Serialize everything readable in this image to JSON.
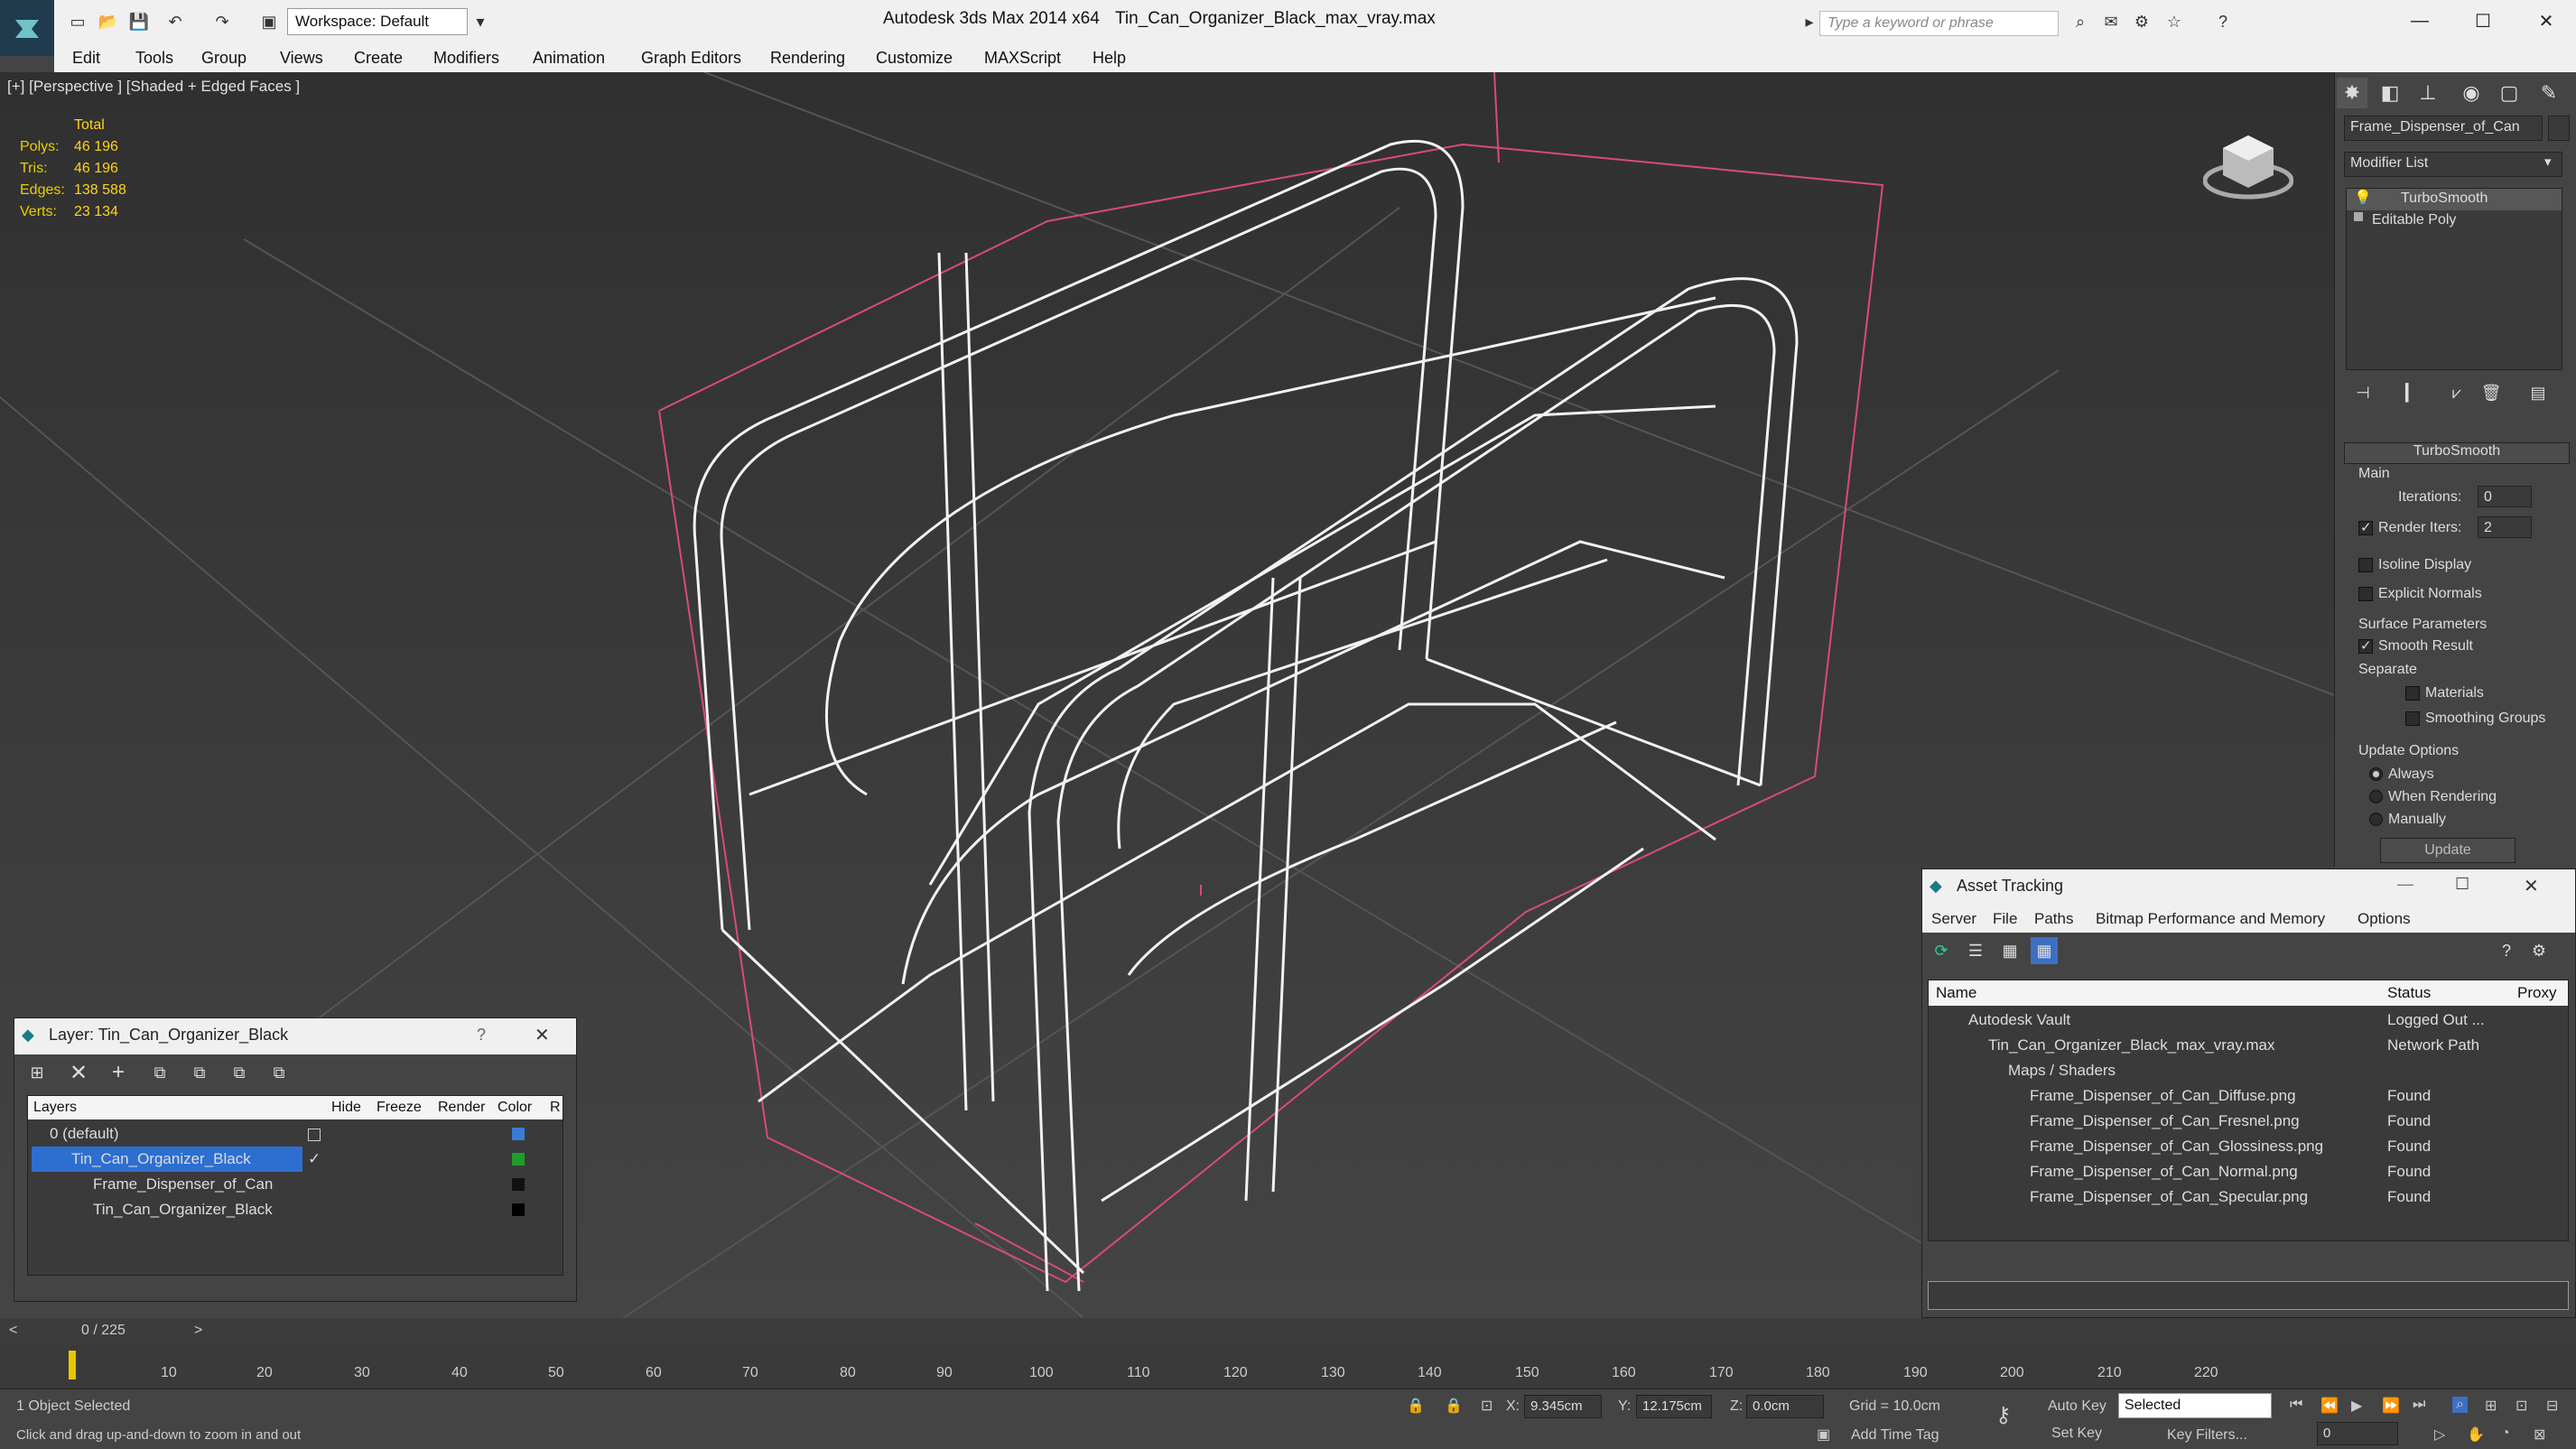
{
  "app": {
    "title": "Autodesk 3ds Max  2014 x64",
    "file": "Tin_Can_Organizer_Black_max_vray.max",
    "workspace": "Workspace: Default",
    "search_placeholder": "Type a keyword or phrase"
  },
  "menu": [
    "Edit",
    "Tools",
    "Group",
    "Views",
    "Create",
    "Modifiers",
    "Animation",
    "Graph Editors",
    "Rendering",
    "Customize",
    "MAXScript",
    "Help"
  ],
  "viewport": {
    "label": "[+] [Perspective ] [Shaded + Edged Faces ]",
    "stats": {
      "header": "Total",
      "rows": [
        {
          "k": "Polys:",
          "v": "46 196"
        },
        {
          "k": "Tris:",
          "v": "46 196"
        },
        {
          "k": "Edges:",
          "v": "138 588"
        },
        {
          "k": "Verts:",
          "v": "23 134"
        }
      ]
    }
  },
  "command_panel": {
    "object_name": "Frame_Dispenser_of_Can",
    "modifier_list": "Modifier List",
    "stack": [
      "TurboSmooth",
      "Editable Poly"
    ],
    "rollout": "TurboSmooth",
    "main": "Main",
    "iterations_label": "Iterations:",
    "iterations": "0",
    "render_iters_label": "Render Iters:",
    "render_iters": "2",
    "isoline": "Isoline Display",
    "explicit": "Explicit Normals",
    "surface": "Surface Parameters",
    "smooth": "Smooth Result",
    "separate": "Separate",
    "materials": "Materials",
    "smoothing": "Smoothing Groups",
    "update_options": "Update Options",
    "always": "Always",
    "when_rendering": "When Rendering",
    "manually": "Manually",
    "update": "Update"
  },
  "layer_window": {
    "title": "Layer: Tin_Can_Organizer_Black",
    "columns": [
      "Layers",
      "Hide",
      "Freeze",
      "Render",
      "Color",
      "R"
    ],
    "rows": [
      {
        "name": "0 (default)",
        "color": "#3a7bd5"
      },
      {
        "name": "Tin_Can_Organizer_Black",
        "color": "#1f9d2a"
      },
      {
        "name": "Frame_Dispenser_of_Can",
        "color": "#111111"
      },
      {
        "name": "Tin_Can_Organizer_Black",
        "color": "#000000"
      }
    ]
  },
  "asset_window": {
    "title": "Asset Tracking",
    "menu": [
      "Server",
      "File",
      "Paths",
      "Bitmap Performance and Memory",
      "Options"
    ],
    "columns": [
      "Name",
      "Status",
      "Proxy"
    ],
    "rows": [
      {
        "name": "Autodesk Vault",
        "status": "Logged Out ..."
      },
      {
        "name": "Tin_Can_Organizer_Black_max_vray.max",
        "status": "Network Path"
      },
      {
        "name": "Maps / Shaders",
        "status": ""
      },
      {
        "name": "Frame_Dispenser_of_Can_Diffuse.png",
        "status": "Found"
      },
      {
        "name": "Frame_Dispenser_of_Can_Fresnel.png",
        "status": "Found"
      },
      {
        "name": "Frame_Dispenser_of_Can_Glossiness.png",
        "status": "Found"
      },
      {
        "name": "Frame_Dispenser_of_Can_Normal.png",
        "status": "Found"
      },
      {
        "name": "Frame_Dispenser_of_Can_Specular.png",
        "status": "Found"
      }
    ]
  },
  "timeline": {
    "frame": "0 / 225",
    "ticks": [
      "10",
      "20",
      "30",
      "40",
      "50",
      "60",
      "70",
      "80",
      "90",
      "100",
      "110",
      "120",
      "130",
      "140",
      "150",
      "160",
      "170",
      "180",
      "190",
      "200",
      "210",
      "220"
    ]
  },
  "status": {
    "selected": "1 Object Selected",
    "hint": "Click and drag up-and-down to zoom in and out",
    "x_label": "X:",
    "x": "9.345cm",
    "y_label": "Y:",
    "y": "12.175cm",
    "z_label": "Z:",
    "z": "0.0cm",
    "grid": "Grid = 10.0cm",
    "add_time_tag": "Add Time Tag",
    "auto_key": "Auto Key",
    "set_key": "Set Key",
    "selected_dd": "Selected",
    "key_filters": "Key Filters...",
    "frame_field": "0"
  }
}
